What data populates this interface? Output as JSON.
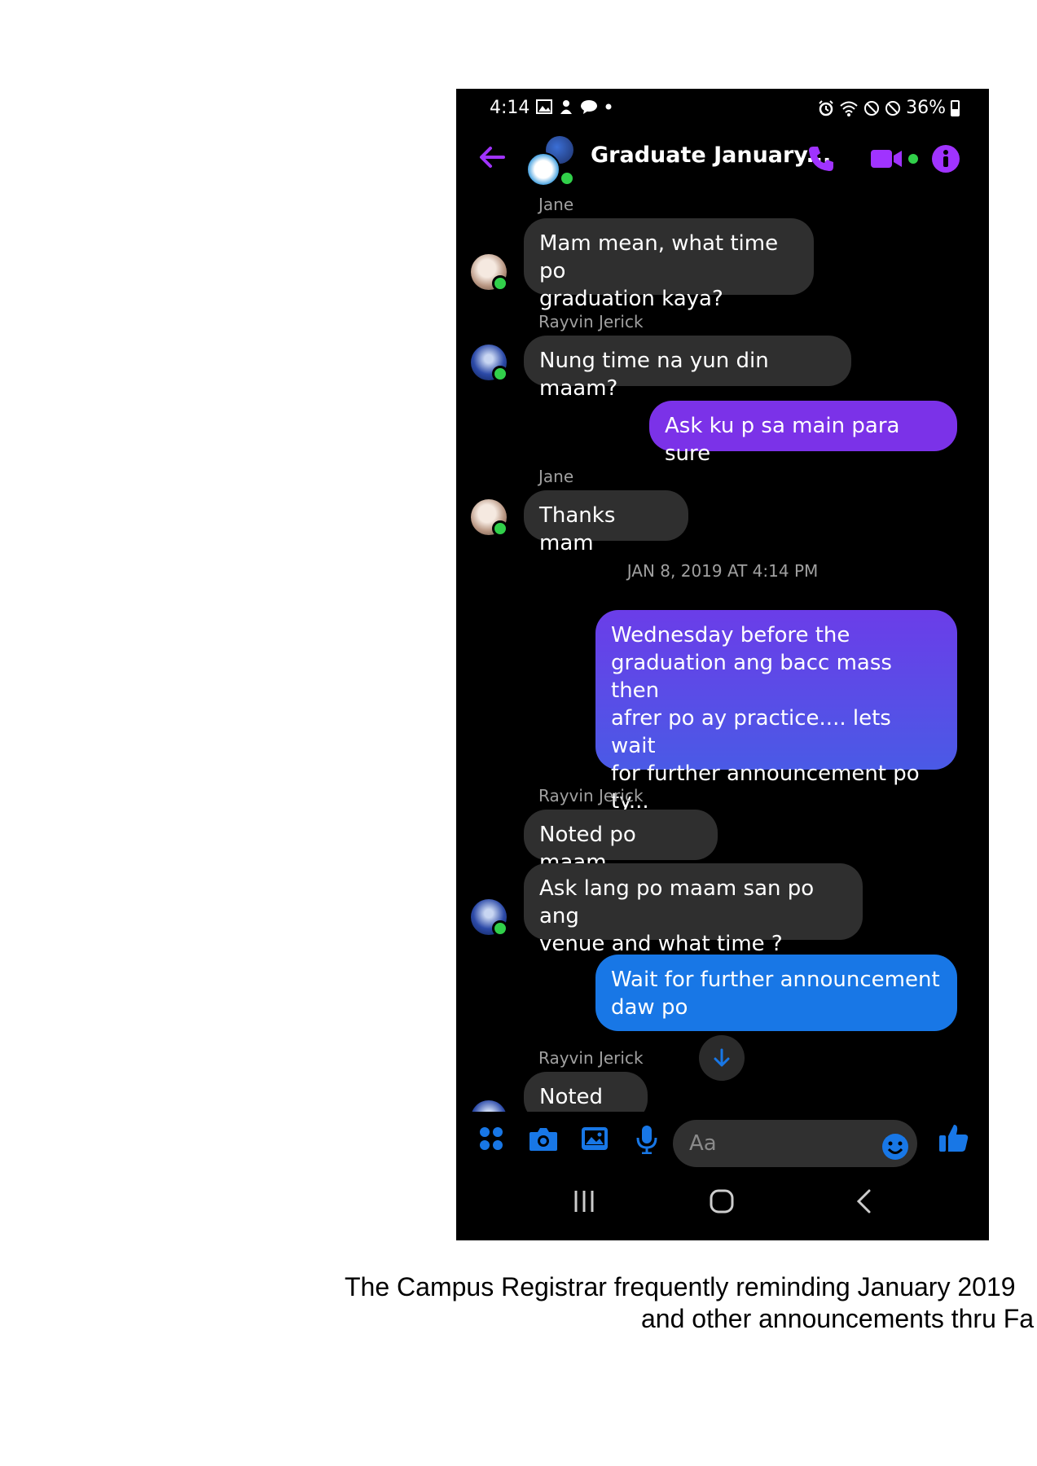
{
  "status_bar": {
    "time": "4:14",
    "battery": "36%"
  },
  "header": {
    "title": "Graduate January..."
  },
  "messages": [
    {
      "sender": "Jane",
      "text": "Mam mean, what time po graduation kaya?",
      "l1": "Mam mean, what time po",
      "l2": "graduation kaya?"
    },
    {
      "sender": "Rayvin Jerick",
      "text": "Nung time na yun din maam?"
    },
    {
      "text": "Ask ku p sa main para sure"
    },
    {
      "sender": "Jane",
      "text": "Thanks mam"
    },
    {
      "l1": "Wednesday before the",
      "l2": "graduation ang bacc mass then",
      "l3": "afrer po ay practice.... lets wait",
      "l4": "for further announcement po",
      "l5": "ty..."
    },
    {
      "sender": "Rayvin Jerick",
      "text": "Noted po maam"
    },
    {
      "l1": "Ask lang po maam san po ang",
      "l2": "venue and what time ?"
    },
    {
      "l1": "Wait for further announcement",
      "l2": "daw po"
    },
    {
      "sender": "Rayvin Jerick",
      "text": "Noted po"
    }
  ],
  "timestamp": "JAN 8, 2019 AT 4:14 PM",
  "composer": {
    "placeholder": "Aa"
  },
  "caption": {
    "line1": "The Campus Registrar frequently reminding January 2019",
    "line2": "and other announcements thru Fa"
  },
  "colors": {
    "accent_purple": "#a033ff",
    "messenger_blue": "#1877e6",
    "online_green": "#31d04a"
  },
  "icons": [
    "back-arrow-icon",
    "phone-icon",
    "video-call-icon",
    "info-icon",
    "apps-icon",
    "camera-icon",
    "gallery-icon",
    "microphone-icon",
    "emoji-icon",
    "thumbs-up-icon",
    "scroll-down-arrow-icon",
    "recents-icon",
    "home-icon",
    "nav-back-icon"
  ]
}
